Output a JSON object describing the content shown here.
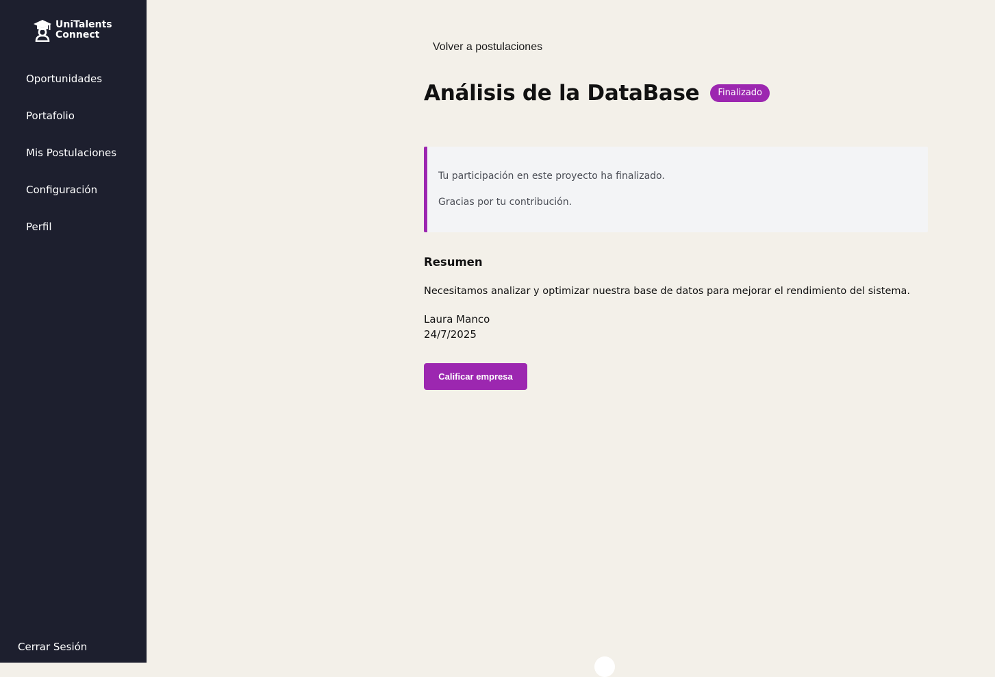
{
  "app": {
    "logo_line1": "UniTalents",
    "logo_line2": "Connect",
    "logo_icon": "graduate-icon"
  },
  "sidebar": {
    "items": [
      {
        "label": "Oportunidades"
      },
      {
        "label": "Portafolio"
      },
      {
        "label": "Mis Postulaciones"
      },
      {
        "label": "Configuración"
      },
      {
        "label": "Perfil"
      }
    ],
    "logout_label": "Cerrar Sesión"
  },
  "main": {
    "back_label": "Volver a postulaciones",
    "title": "Análisis de la DataBase",
    "status": "Finalizado",
    "notice": {
      "line1": "Tu participación en este proyecto ha finalizado.",
      "line2": "Gracias por tu contribución."
    },
    "summary_heading": "Resumen",
    "summary_text": "Necesitamos analizar y optimizar nuestra base de datos para mejorar el rendimiento del sistema.",
    "company_contact": "Laura Manco",
    "date": "24/7/2025",
    "rate_button_label": "Calificar empresa"
  },
  "colors": {
    "sidebar_bg": "#1d1f2e",
    "page_bg": "#f3f0e9",
    "accent": "#9c27b0",
    "notice_bg": "#f3f4f6"
  }
}
